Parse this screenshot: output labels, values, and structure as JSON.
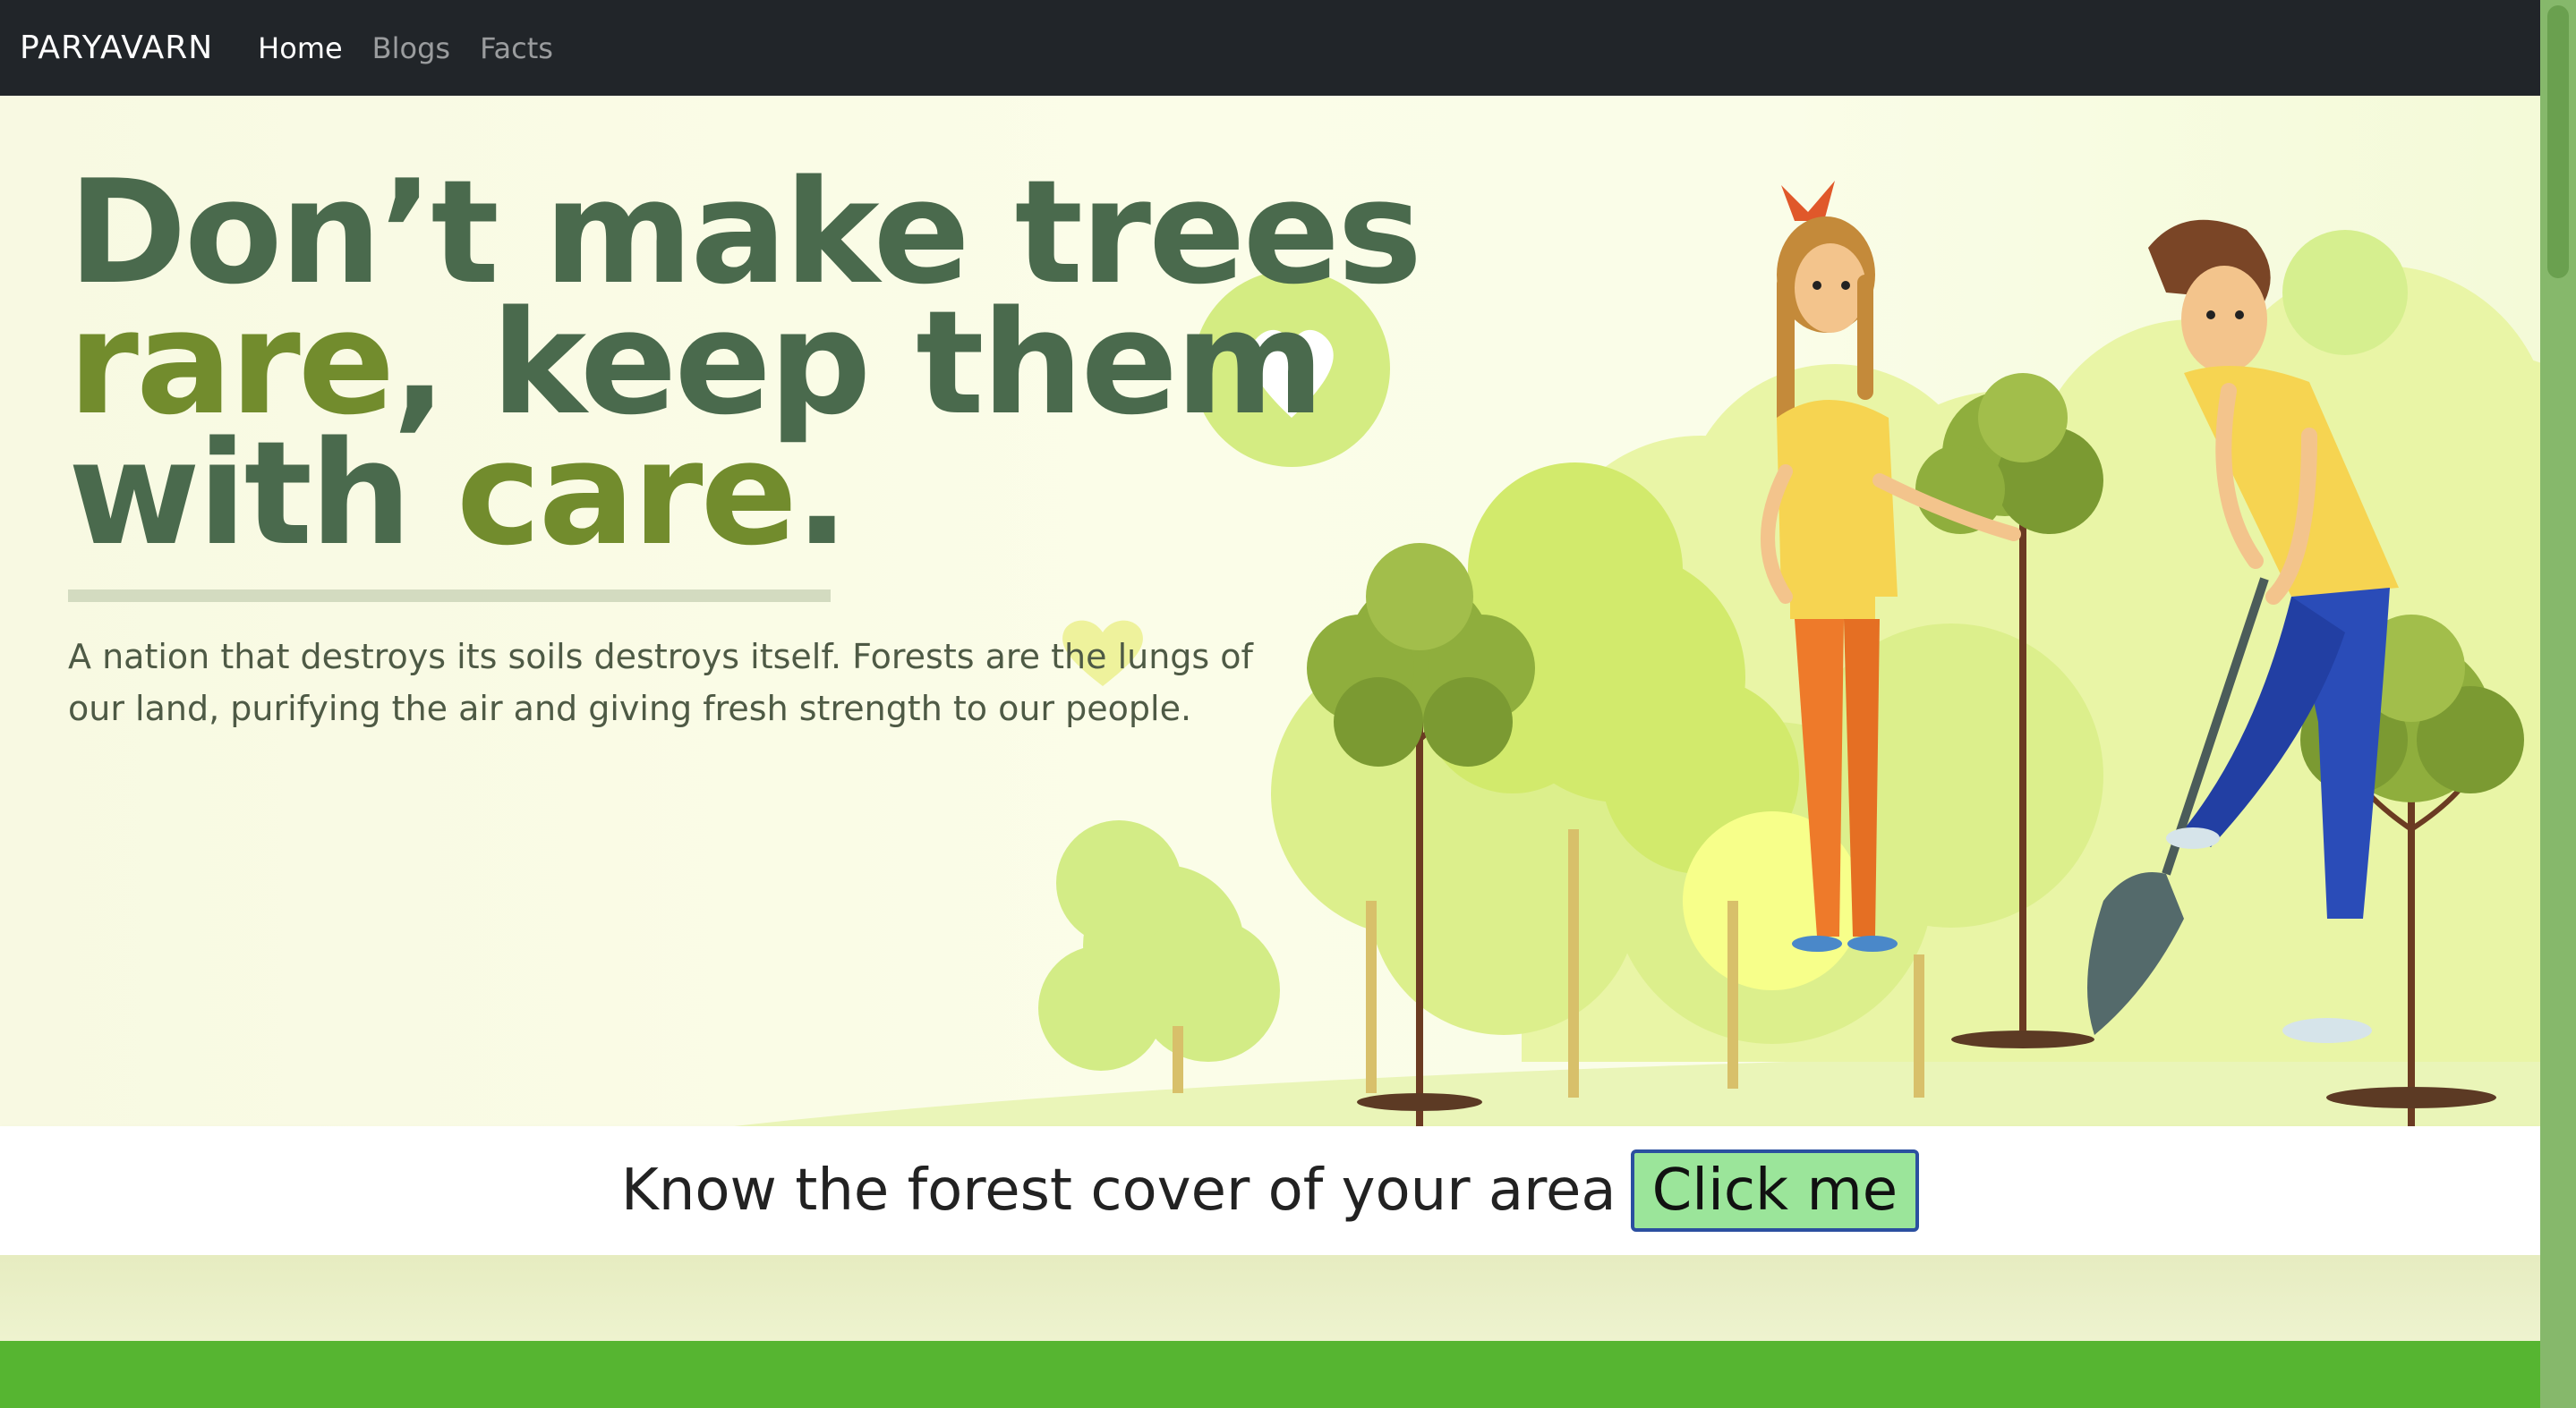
{
  "navbar": {
    "brand": "PARYAVARN",
    "links": [
      {
        "label": "Home",
        "active": true
      },
      {
        "label": "Blogs",
        "active": false
      },
      {
        "label": "Facts",
        "active": false
      }
    ]
  },
  "hero": {
    "headline": {
      "part1": "Don’t make trees",
      "part2": "rare",
      "part3": ", keep them",
      "part4": "with ",
      "part5": "care",
      "part6": "."
    },
    "tagline": "A nation that destroys its soils destroys itself. Forests are the lungs of our land, purifying the air and giving fresh strength to our people."
  },
  "cta": {
    "text": "Know the forest cover of your area",
    "button_label": "Click me"
  },
  "colors": {
    "navbar_bg": "#212529",
    "headline_dark": "#4a6a4d",
    "headline_accent": "#728c2d",
    "button_bg": "#9be59a",
    "button_border": "#2b4fa0",
    "footer_green": "#56b531"
  },
  "icons": [
    "heart-icon",
    "tree-illustration",
    "girl-illustration",
    "boy-with-shovel-illustration"
  ]
}
